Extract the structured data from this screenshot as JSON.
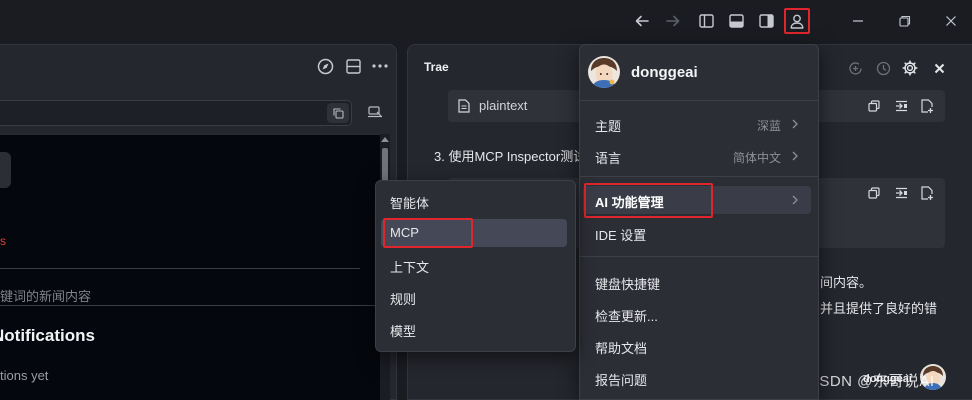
{
  "titlebar": {
    "icons": [
      "arrow-left-icon",
      "arrow-right-icon",
      "sidebar-left-icon",
      "panel-bottom-icon",
      "sidebar-right-icon",
      "user-icon",
      "minimize-icon",
      "restore-icon",
      "close-icon"
    ]
  },
  "left_panel": {
    "header_icons": [
      "compass-icon",
      "layout-icon",
      "more-icon"
    ],
    "news_placeholder": "键词的新闻内容",
    "notifications_heading": "Notifications",
    "notifications_empty": "tions yet"
  },
  "right_panel": {
    "title": "Trae",
    "code_block_1": {
      "label": "plaintext"
    },
    "step_3": "3. 使用MCP Inspector测试",
    "partial_line_1": "间内容。",
    "partial_line_2": "并且提供了良好的错",
    "footer_user": "donggeai",
    "accent_color": "#e0262c"
  },
  "account_menu": {
    "username": "donggeai",
    "items": [
      {
        "label": "主题",
        "value": "深蓝",
        "has_submenu": true
      },
      {
        "label": "语言",
        "value": "简体中文",
        "has_submenu": true
      },
      {
        "label": "AI 功能管理",
        "value": "",
        "has_submenu": true,
        "highlighted": true
      },
      {
        "label": "IDE 设置",
        "value": "",
        "has_submenu": false
      },
      {
        "label": "键盘快捷键",
        "value": "",
        "has_submenu": false
      },
      {
        "label": "检查更新...",
        "value": "",
        "has_submenu": false
      },
      {
        "label": "帮助文档",
        "value": "",
        "has_submenu": false
      },
      {
        "label": "报告问题",
        "value": "",
        "has_submenu": false
      }
    ]
  },
  "ai_menu": {
    "items": [
      {
        "label": "智能体"
      },
      {
        "label": "MCP",
        "highlighted": true
      },
      {
        "label": "上下文"
      },
      {
        "label": "规则"
      },
      {
        "label": "模型"
      }
    ]
  },
  "watermark": "CSDN @东哥说AI"
}
